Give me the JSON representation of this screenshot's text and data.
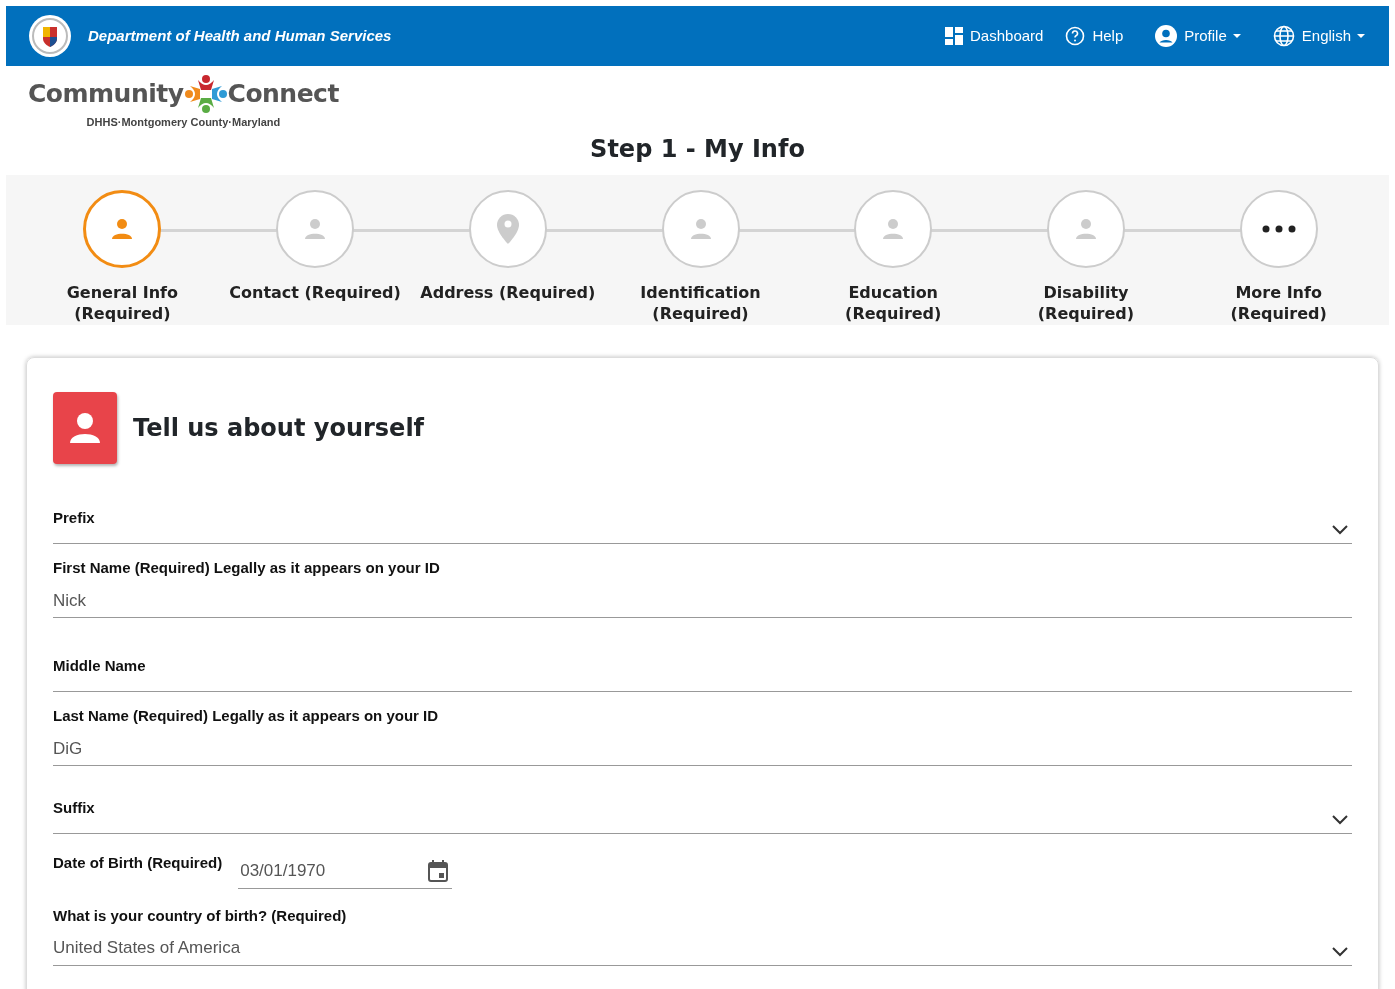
{
  "header": {
    "title": "Department of Health and Human Services",
    "nav": [
      {
        "label": "Dashboard",
        "kind": "dashboard",
        "dropdown": false
      },
      {
        "label": "Help",
        "kind": "help",
        "dropdown": false
      },
      {
        "label": "Profile",
        "kind": "user",
        "dropdown": true
      },
      {
        "label": "English",
        "kind": "globe",
        "dropdown": true
      }
    ]
  },
  "brand": {
    "left": "Community",
    "right": "Connect",
    "tagline": "DHHS·Montgomery County·Maryland"
  },
  "page_title": "Step 1 - My Info",
  "steps": [
    {
      "label": "General Info (Required)",
      "kind": "person",
      "selected": true
    },
    {
      "label": "Contact (Required)",
      "kind": "person",
      "selected": false
    },
    {
      "label": "Address (Required)",
      "kind": "pin",
      "selected": false
    },
    {
      "label": "Identification (Required)",
      "kind": "person",
      "selected": false
    },
    {
      "label": "Education (Required)",
      "kind": "person",
      "selected": false
    },
    {
      "label": "Disability (Required)",
      "kind": "person",
      "selected": false
    },
    {
      "label": "More Info (Required)",
      "kind": "more",
      "selected": false
    }
  ],
  "form": {
    "title": "Tell us about yourself",
    "fields": [
      {
        "kind": "select",
        "label": "Prefix"
      },
      {
        "kind": "text",
        "label": "First Name (Required) Legally as it appears on your ID",
        "value": "Nick"
      },
      {
        "kind": "text",
        "label": "Middle Name"
      },
      {
        "kind": "text",
        "label": "Last Name (Required) Legally as it appears on your ID",
        "value": "DiG"
      },
      {
        "kind": "select",
        "label": "Suffix"
      },
      {
        "kind": "date",
        "label": "Date of Birth (Required)",
        "value": "03/01/1970"
      },
      {
        "kind": "select",
        "label": "What is your country of birth? (Required)",
        "value": "United States of America"
      }
    ]
  }
}
